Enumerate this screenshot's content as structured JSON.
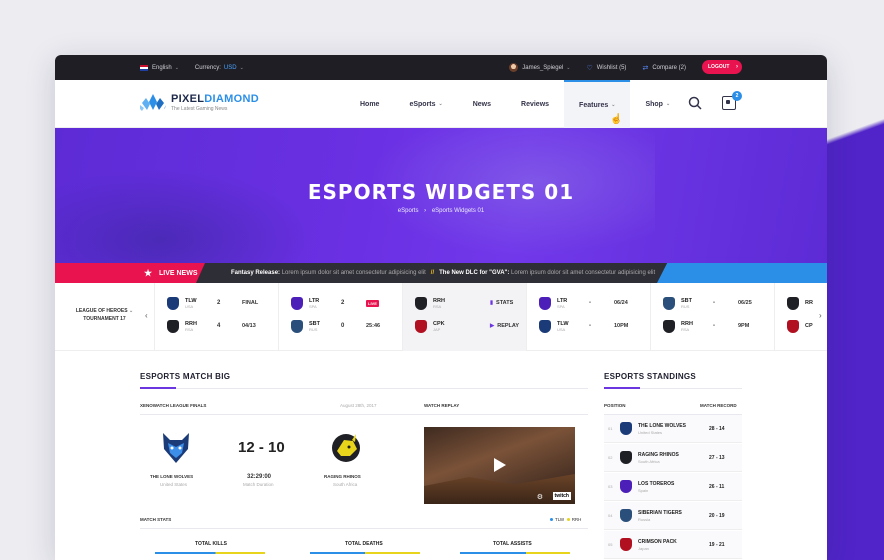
{
  "topbar": {
    "language": "English",
    "currency_label": "Currency:",
    "currency_value": "USD",
    "user": "James_Spiegel",
    "wishlist": "Wishlist (5)",
    "compare": "Compare (2)",
    "logout": "LOGOUT"
  },
  "logo": {
    "name_a": "PIXEL",
    "name_b": "DIAMOND",
    "tagline": "The Latest Gaming News"
  },
  "nav": {
    "items": [
      {
        "label": "Home"
      },
      {
        "label": "eSports"
      },
      {
        "label": "News"
      },
      {
        "label": "Reviews"
      },
      {
        "label": "Features"
      },
      {
        "label": "Shop"
      }
    ],
    "cart_count": "2"
  },
  "hero": {
    "title": "ESPORTS WIDGETS 01",
    "crumb_1": "eSports",
    "crumb_sep": "›",
    "crumb_2": "eSports Widgets 01"
  },
  "ticker": {
    "label": "LIVE NEWS",
    "item1_title": "Fantasy Release:",
    "item1_text": "Lorem ipsum dolor sit amet consectetur adipisicing elit",
    "sep": "//",
    "item2_title": "The New DLC for \"GVA\":",
    "item2_text": "Lorem ipsum dolor sit amet consectetur adipisicing elit"
  },
  "scores": {
    "league_line1": "LEAGUE OF HEROES",
    "league_line2": "TOURNAMENT 17",
    "matches": [
      {
        "t1": "TLW",
        "t1c": "USA",
        "s1": "2",
        "t2": "RRH",
        "t2c": "RSA",
        "s2": "4",
        "st1": "FINAL",
        "st2": "04/13"
      },
      {
        "t1": "LTR",
        "t1c": "SPA",
        "s1": "2",
        "t2": "SBT",
        "t2c": "RUS",
        "s2": "0",
        "st1": "LIVE",
        "st2": "25:46"
      },
      {
        "t1": "RRH",
        "t1c": "RSA",
        "s1": "",
        "t2": "CPK",
        "t2c": "JAP",
        "s2": "",
        "st1": "STATS",
        "st2": "REPLAY"
      },
      {
        "t1": "LTR",
        "t1c": "SPA",
        "s1": "-",
        "t2": "TLW",
        "t2c": "USA",
        "s2": "-",
        "st1": "06/24",
        "st2": "10PM"
      },
      {
        "t1": "SBT",
        "t1c": "RUS",
        "s1": "-",
        "t2": "RRH",
        "t2c": "RSA",
        "s2": "-",
        "st1": "06/25",
        "st2": "9PM"
      },
      {
        "t1": "RR",
        "t1c": "",
        "s1": "",
        "t2": "CP",
        "t2c": "",
        "s2": "",
        "st1": "",
        "st2": ""
      }
    ]
  },
  "match_big": {
    "title": "ESPORTS MATCH BIG",
    "league": "XENOWATCH LEAGUE FINALS",
    "date": "August 28th, 2017",
    "team1": "THE LONE WOLVES",
    "team1_country": "United States",
    "team2": "RAGING RHINOS",
    "team2_country": "South Africa",
    "score": "12 - 10",
    "duration": "32:29:00",
    "duration_label": "Match Duration",
    "replay_label": "WATCH REPLAY",
    "twitch": "twitch",
    "stats_label": "MATCH STATS",
    "legend_1": "TLW",
    "legend_2": "RRH",
    "stat_1": "TOTAL KILLS",
    "stat_2": "TOTAL DEATHS",
    "stat_3": "TOTAL ASSISTS"
  },
  "standings": {
    "title": "ESPORTS STANDINGS",
    "col_pos": "POSITION",
    "col_record": "MATCH RECORD",
    "rows": [
      {
        "pos": "01",
        "name": "THE LONE WOLVES",
        "country": "United States",
        "record": "28 - 14"
      },
      {
        "pos": "02",
        "name": "RAGING RHINOS",
        "country": "South Africa",
        "record": "27 - 13"
      },
      {
        "pos": "03",
        "name": "LOS TOREROS",
        "country": "Spain",
        "record": "26 - 11"
      },
      {
        "pos": "04",
        "name": "SIBERIAN TIGERS",
        "country": "Russia",
        "record": "20 - 19"
      },
      {
        "pos": "05",
        "name": "CRIMSON PACK",
        "country": "Japan",
        "record": "19 - 21"
      }
    ]
  },
  "colors": {
    "accent": "#2b8fe8",
    "pink": "#e8134f",
    "purple": "#6b35e0"
  }
}
